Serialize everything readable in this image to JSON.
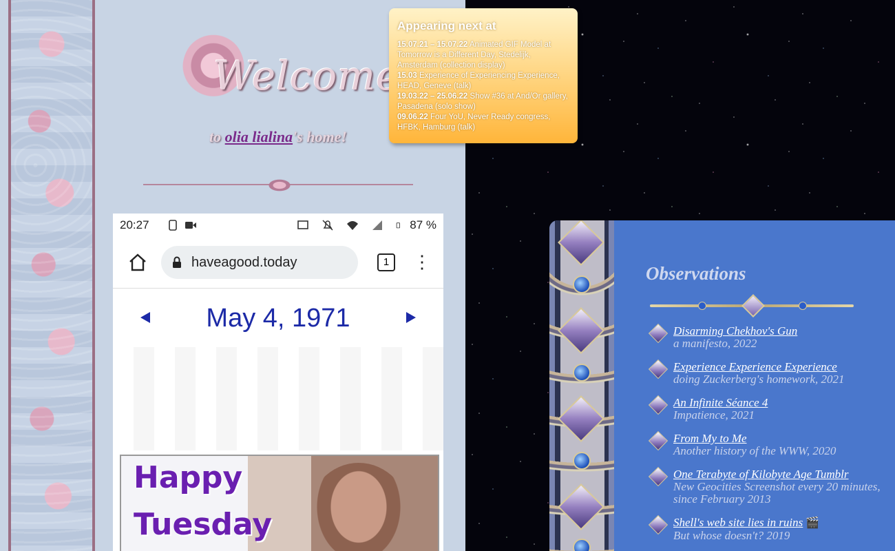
{
  "greeting": {
    "prefix": "to ",
    "name_link": "olia lialina",
    "suffix": "'s home!"
  },
  "welcome_graphic_text": "Welcome",
  "phone_screenshot": {
    "time": "20:27",
    "battery": "87 %",
    "url": "haveagood.today",
    "tabs_count": "1",
    "date": "May 4, 1971",
    "gif_line1": "Happy",
    "gif_line2": "Tuesday"
  },
  "appearing_next": {
    "title": "Appearing next at",
    "events": [
      {
        "date": "15.07.21 – 15.07.22",
        "text": "Animated GIF Model at Tomorrow is a Different Day, Stedelijk, Amsterdam (collection display)"
      },
      {
        "date": "15.03",
        "text": "Experience of Experiencing Experience, HEAD, Geneve (talk)"
      },
      {
        "date": "19.03.22 – 25.06.22",
        "text": "Show #36 at And/Or gallery, Pasadena (solo show)"
      },
      {
        "date": "09.06.22",
        "text": "Four YoU, Never Ready congress, HFBK, Hamburg (talk)"
      }
    ]
  },
  "observations": {
    "title": "Observations",
    "items": [
      {
        "link": "Disarming Chekhov's Gun",
        "sub": "a manifesto, 2022"
      },
      {
        "link": "Experience Experience Experience",
        "sub": "doing Zuckerberg's homework, 2021"
      },
      {
        "link": "An Infinite Séance 4",
        "sub": "Impatience, 2021"
      },
      {
        "link": "From My to Me",
        "sub": "Another history of the WWW, 2020"
      },
      {
        "link": "One Terabyte of Kilobyte Age Tumblr",
        "sub": "New Geocities Screenshot every 20 minutes, since February 2013"
      },
      {
        "link": "Shell's web site lies in ruins",
        "sub": "But whose doesn't? 2019",
        "icon": "clapperboard-icon"
      }
    ]
  },
  "colors": {
    "left_bg": "#c8d4e4",
    "right_panel": "#4a77cc",
    "link_purple": "#7a2a8a",
    "date_blue": "#1c2aa7",
    "info_orange": "#ffb53a"
  }
}
